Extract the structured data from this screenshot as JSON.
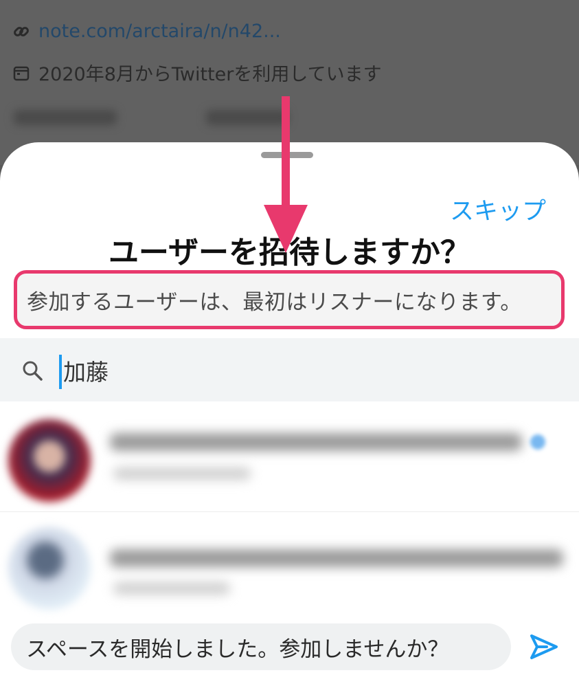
{
  "background_profile": {
    "link_text": "note.com/arctaira/n/n42...",
    "joined_text": "2020年8月からTwitterを利用しています",
    "link_icon": "link-icon",
    "calendar_icon": "calendar-icon"
  },
  "sheet": {
    "skip_label": "スキップ",
    "title": "ユーザーを招待しますか？",
    "subtitle": "参加するユーザーは、最初はリスナーになります。"
  },
  "search": {
    "value": "加藤",
    "icon": "search-icon"
  },
  "users": [
    {
      "avatar": "avatar-1",
      "blurred": true
    },
    {
      "avatar": "avatar-2",
      "blurred": true
    }
  ],
  "reply": {
    "text": "スペースを開始しました。参加しませんか？",
    "send_icon": "send-icon"
  },
  "colors": {
    "accent": "#1d9bf0",
    "annotation": "#e8396d"
  }
}
